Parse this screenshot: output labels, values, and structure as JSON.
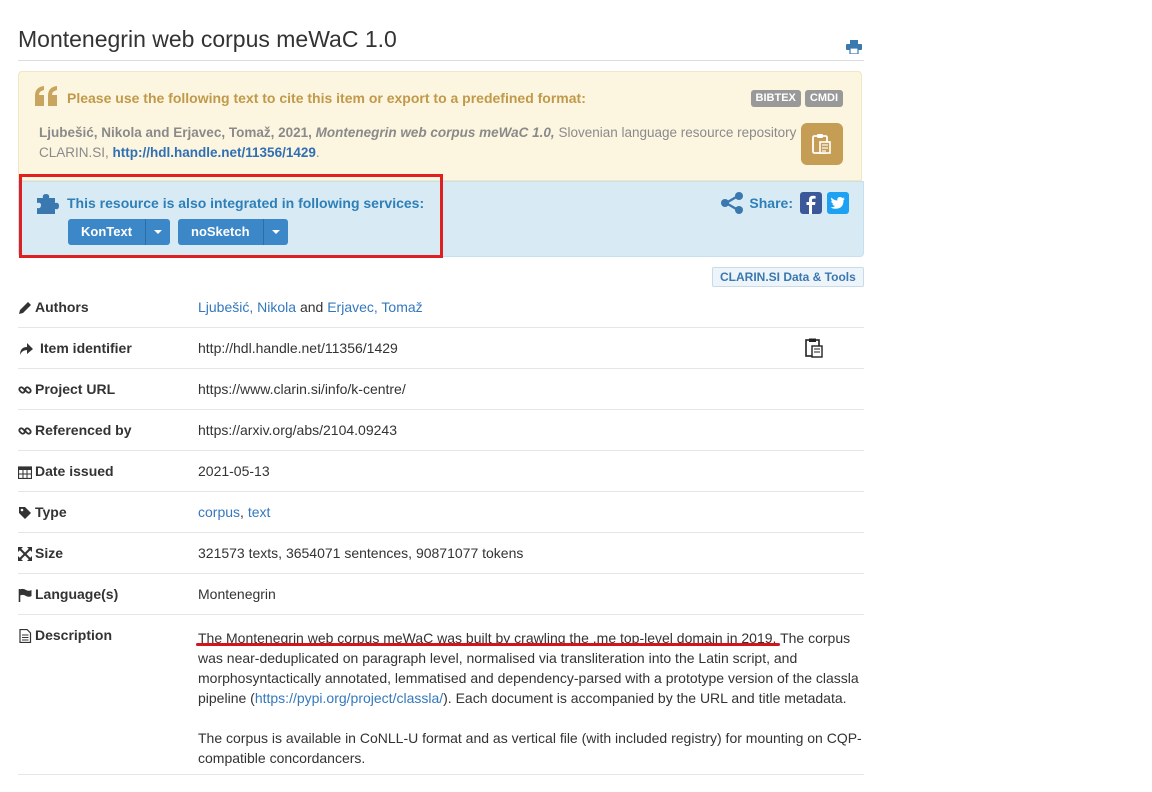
{
  "page_title": "Montenegrin web corpus meWaC 1.0",
  "citation": {
    "heading": "Please use the following text to cite this item or export to a predefined format:",
    "badges": [
      "BIBTEX",
      "CMDI"
    ],
    "authors": "Ljubešić, Nikola and Erjavec, Tomaž, 2021,",
    "title_italic": "Montenegrin web corpus meWaC 1.0,",
    "repository": "Slovenian language resource repository CLARIN.SI,",
    "handle_link": "http://hdl.handle.net/11356/1429",
    "trailing_period": "."
  },
  "services": {
    "heading": "This resource is also integrated in following services:",
    "buttons": [
      "KonText",
      "noSketch"
    ],
    "share_label": "Share:"
  },
  "tools_badge": "CLARIN.SI Data & Tools",
  "metadata": {
    "authors": {
      "label": "Authors",
      "author1": "Ljubešić, Nikola",
      "conj": "and",
      "author2": "Erjavec, Tomaž"
    },
    "identifier": {
      "label": "Item identifier",
      "value": "http://hdl.handle.net/11356/1429"
    },
    "project_url": {
      "label": "Project URL",
      "value": "https://www.clarin.si/info/k-centre/"
    },
    "referenced_by": {
      "label": "Referenced by",
      "value": "https://arxiv.org/abs/2104.09243"
    },
    "date_issued": {
      "label": "Date issued",
      "value": "2021-05-13"
    },
    "type": {
      "label": "Type",
      "value1": "corpus",
      "sep": ",",
      "value2": "text"
    },
    "size": {
      "label": "Size",
      "value": "321573 texts, 3654071 sentences, 90871077 tokens"
    },
    "languages": {
      "label": "Language(s)",
      "value": "Montenegrin"
    },
    "description": {
      "label": "Description",
      "p1_a": "The Montenegrin web corpus meWaC was built by crawling the .me top-level domain in 2019. The corpus was near-deduplicated on paragraph level, normalised via transliteration into the Latin script, and morphosyntactically annotated, lemmatised and dependency-parsed with a prototype version of the classla pipeline (",
      "p1_link": "https://pypi.org/project/classla/",
      "p1_b": "). Each document is accompanied by the URL and title metadata.",
      "p2": "The corpus is available in CoNLL-U format and as vertical file (with included registry) for mounting on CQP-compatible concordancers."
    }
  },
  "colors": {
    "accent": "#3b87c8",
    "cite_bg": "#fcf5e0",
    "services_bg": "#d8ebf5",
    "annotation_red": "#e02020"
  }
}
